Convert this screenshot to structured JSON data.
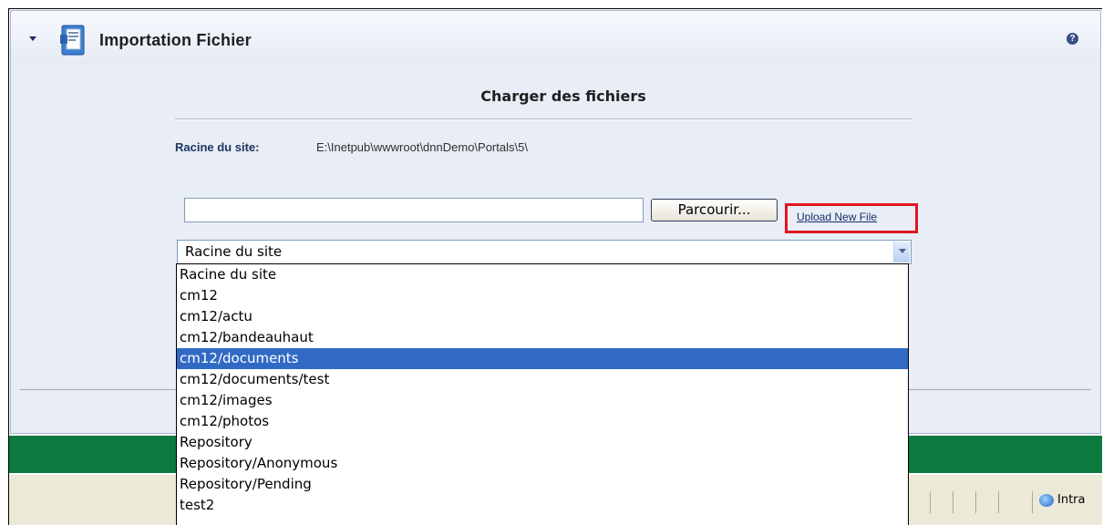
{
  "module": {
    "title": "Importation Fichier",
    "help_glyph": "?"
  },
  "upload": {
    "section_title": "Charger des fichiers",
    "root_label": "Racine du site:",
    "root_path": "E:\\Inetpub\\wwwroot\\dnnDemo\\Portals\\5\\",
    "file_value": "",
    "browse_label": "Parcourir...",
    "upload_link": "Upload New File",
    "folder_selected": "Racine du site",
    "highlight_color": "#e1151e"
  },
  "folders": [
    "Racine du site",
    "cm12",
    "cm12/actu",
    "cm12/bandeauhaut",
    "cm12/documents",
    "cm12/documents/test",
    "cm12/images",
    "cm12/photos",
    "Repository",
    "Repository/Anonymous",
    "Repository/Pending",
    "test2"
  ],
  "highlighted_folder": "cm12/documents",
  "statusbar": {
    "zone_label": "Intra"
  },
  "colors": {
    "panel_background": "#e8edf6",
    "band_green": "#0a7a3f",
    "selection_blue": "#316ac5"
  },
  "icons": [
    "collapse-arrow-icon",
    "file-module-icon",
    "help-icon",
    "chevron-down-icon",
    "intranet-zone-icon"
  ]
}
